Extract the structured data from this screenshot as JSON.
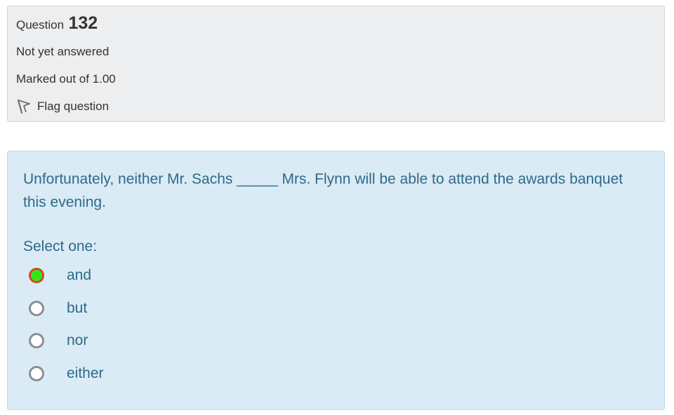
{
  "info": {
    "question_label": "Question",
    "question_number": "132",
    "state": "Not yet answered",
    "grade": "Marked out of 1.00",
    "flag_label": "Flag question"
  },
  "question": {
    "text": "Unfortunately, neither Mr. Sachs _____ Mrs. Flynn will be able to attend the awards banquet this evening.",
    "prompt": "Select one:",
    "options": [
      {
        "label": "and",
        "selected": true
      },
      {
        "label": "but",
        "selected": false
      },
      {
        "label": "nor",
        "selected": false
      },
      {
        "label": "either",
        "selected": false
      }
    ]
  },
  "colors": {
    "info_background": "#edeef0",
    "content_background": "#daebf5",
    "content_text": "#2c6a8a",
    "selected_radio_fill": "#33e61a",
    "selected_radio_border": "#d9452b"
  },
  "icons": {
    "flag": "flag-icon"
  }
}
